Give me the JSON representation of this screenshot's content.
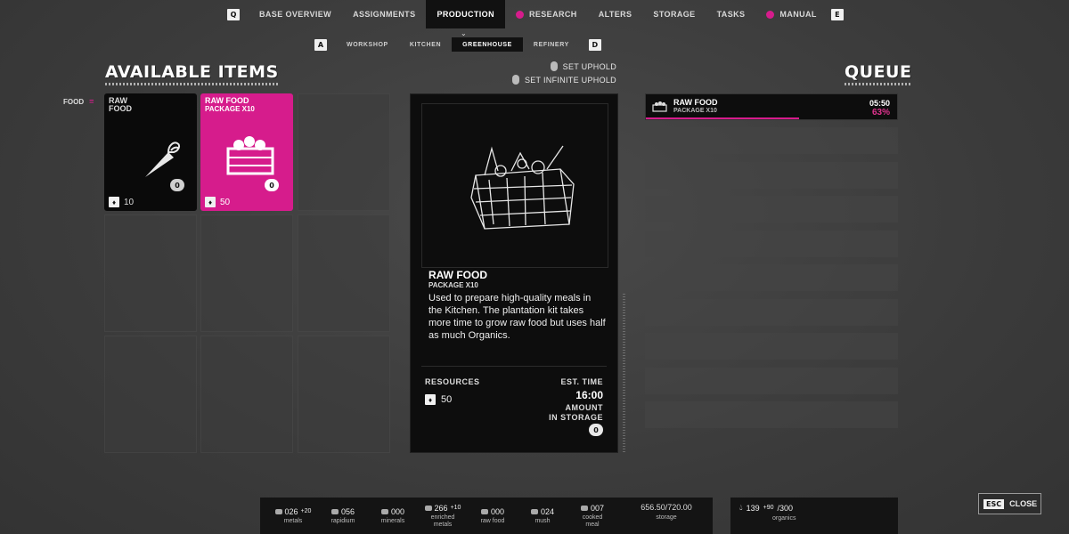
{
  "topnav": {
    "left_key": "Q",
    "right_key": "E",
    "tabs": [
      {
        "label": "BASE OVERVIEW",
        "dot": false,
        "active": false
      },
      {
        "label": "ASSIGNMENTS",
        "dot": false,
        "active": false
      },
      {
        "label": "PRODUCTION",
        "dot": false,
        "active": true
      },
      {
        "label": "RESEARCH",
        "dot": true,
        "active": false
      },
      {
        "label": "ALTERS",
        "dot": false,
        "active": false
      },
      {
        "label": "STORAGE",
        "dot": false,
        "active": false
      },
      {
        "label": "TASKS",
        "dot": false,
        "active": false
      },
      {
        "label": "MANUAL",
        "dot": true,
        "active": false
      }
    ]
  },
  "subnav": {
    "left_key": "A",
    "right_key": "D",
    "tabs": [
      {
        "label": "WORKSHOP",
        "active": false
      },
      {
        "label": "KITCHEN",
        "active": false
      },
      {
        "label": "GREENHOUSE",
        "active": true
      },
      {
        "label": "REFINERY",
        "active": false
      }
    ]
  },
  "available_items": {
    "heading": "AVAILABLE ITEMS",
    "category": "FOOD",
    "items": [
      {
        "name": "RAW",
        "name2": "FOOD",
        "subtitle": "",
        "count": "0",
        "cost": "10",
        "selected": false
      },
      {
        "name": "RAW FOOD",
        "name2": "",
        "subtitle": "PACKAGE X10",
        "count": "0",
        "cost": "50",
        "selected": true
      }
    ]
  },
  "uphold": {
    "set_uphold": "SET UPHOLD",
    "set_infinite": "SET INFINITE UPHOLD"
  },
  "detail": {
    "title": "RAW FOOD",
    "subtitle": "PACKAGE X10",
    "description": "Used to prepare high-quality meals in the Kitchen. The plantation kit takes more time to grow raw food but uses half as much Organics.",
    "resources_label": "RESOURCES",
    "resources_value": "50",
    "est_time_label": "EST. TIME",
    "est_time_value": "16:00",
    "amount_label_1": "AMOUNT",
    "amount_label_2": "IN STORAGE",
    "amount_value": "0"
  },
  "queue": {
    "heading": "QUEUE",
    "active": {
      "name": "RAW FOOD",
      "subtitle": "PACKAGE X10",
      "time": "05:50",
      "percent": "63%",
      "progress": 0.63
    },
    "empty_slots": 9
  },
  "resources": [
    {
      "value": "026",
      "delta": "+20",
      "label": "metals",
      "label2": ""
    },
    {
      "value": "056",
      "delta": "",
      "label": "rapidium",
      "label2": ""
    },
    {
      "value": "000",
      "delta": "",
      "label": "minerals",
      "label2": ""
    },
    {
      "value": "266",
      "delta": "+10",
      "label": "enriched",
      "label2": "metals"
    },
    {
      "value": "000",
      "delta": "",
      "label": "raw food",
      "label2": ""
    },
    {
      "value": "024",
      "delta": "",
      "label": "mush",
      "label2": ""
    },
    {
      "value": "007",
      "delta": "",
      "label": "cooked",
      "label2": "meal"
    }
  ],
  "storage": {
    "value": "656.50/720.00",
    "label": "storage"
  },
  "organics": {
    "value": "139",
    "delta": "+90",
    "max": "/300",
    "label": "organics"
  },
  "close": {
    "key": "ESC",
    "label": "CLOSE"
  },
  "colors": {
    "accent": "#d61c8c",
    "panel": "#0d0d0d"
  }
}
